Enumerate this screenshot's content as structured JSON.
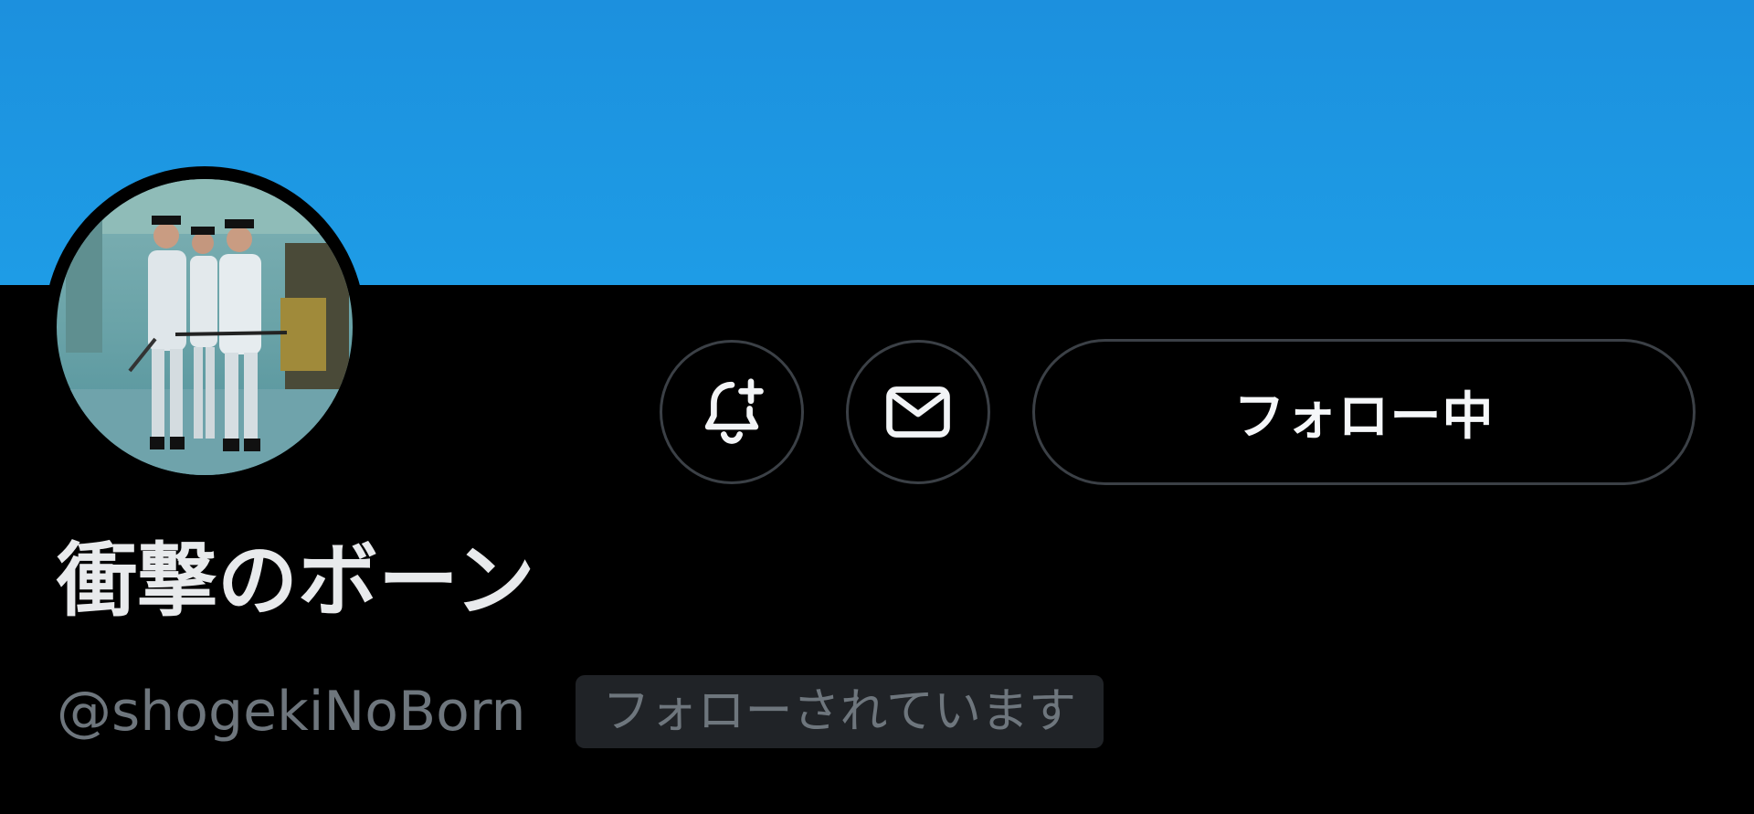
{
  "profile": {
    "display_name": "衝撃のボーン",
    "handle": "@shogekiNoBorn",
    "follows_you_badge": "フォローされています"
  },
  "actions": {
    "notify_icon": "bell-plus-icon",
    "message_icon": "envelope-icon",
    "follow_label": "フォロー中"
  },
  "colors": {
    "banner": "#1d97e2",
    "background": "#000000",
    "button_border": "#3b4046",
    "secondary_text": "#6e767d",
    "badge_bg": "#202327"
  }
}
